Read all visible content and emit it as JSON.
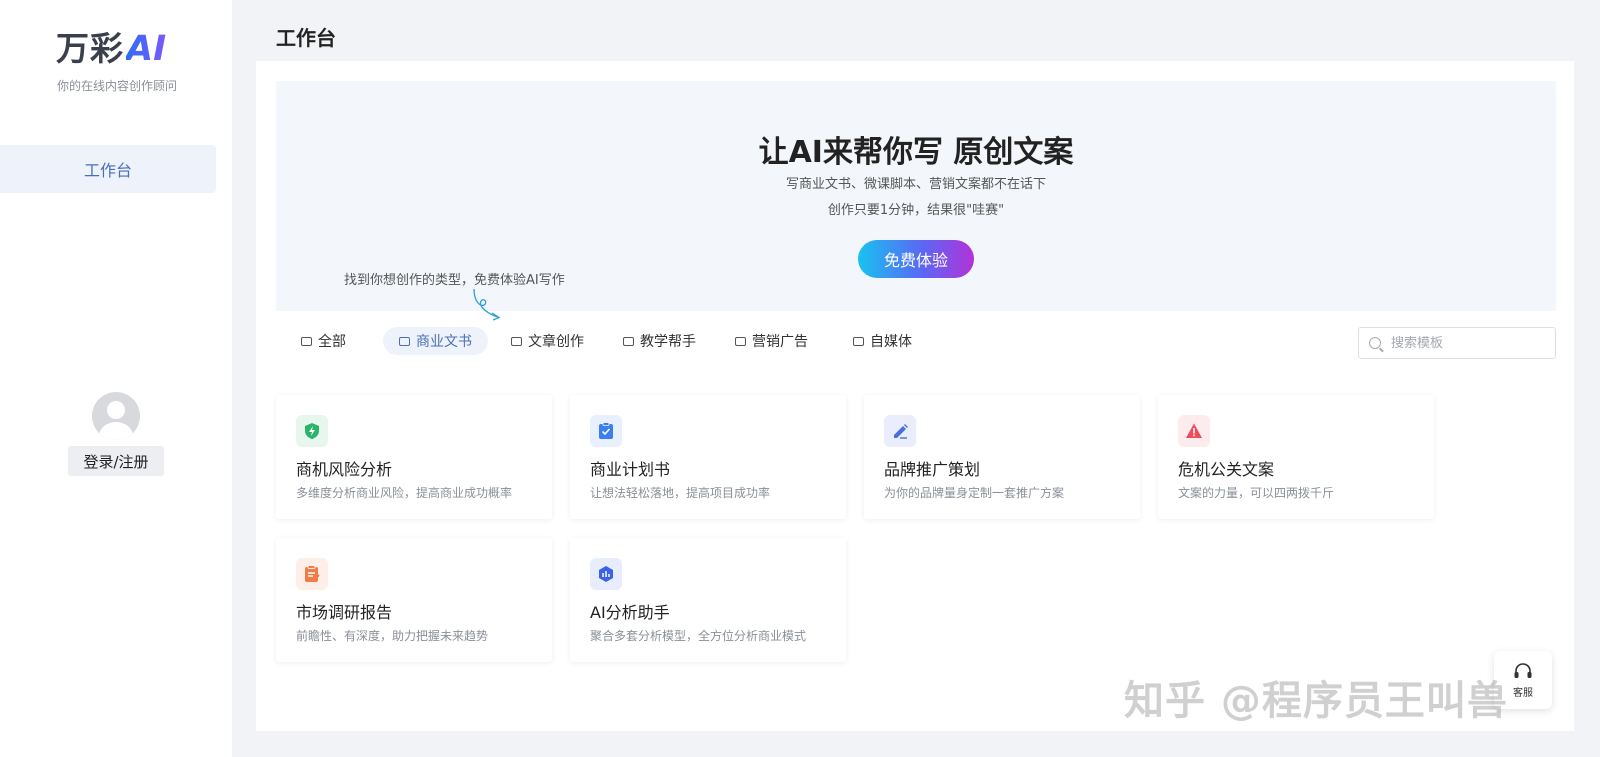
{
  "sidebar": {
    "logo_text": "万彩",
    "logo_ai": "AI",
    "slogan": "你的在线内容创作顾问",
    "nav": [
      {
        "label": "工作台"
      }
    ],
    "login_label": "登录/注册"
  },
  "page": {
    "title": "工作台"
  },
  "banner": {
    "title": "让AI来帮你写 原创文案",
    "subtitle_1": "写商业文书、微课脚本、营销文案都不在话下",
    "subtitle_2": "创作只要1分钟，结果很\"哇赛\"",
    "cta_label": "免费体验",
    "hint": "找到你想创作的类型，免费体验AI写作"
  },
  "tabs": [
    {
      "label": "全部",
      "active": false
    },
    {
      "label": "商业文书",
      "active": true
    },
    {
      "label": "文章创作",
      "active": false
    },
    {
      "label": "教学帮手",
      "active": false
    },
    {
      "label": "营销广告",
      "active": false
    },
    {
      "label": "自媒体",
      "active": false
    }
  ],
  "search": {
    "placeholder": "搜索模板"
  },
  "cards": [
    {
      "title": "商机风险分析",
      "desc": "多维度分析商业风险，提高商业成功概率",
      "icon": "shield-bolt-icon",
      "color": "#2bb36a",
      "bg": "#e8f7ee"
    },
    {
      "title": "商业计划书",
      "desc": "让想法轻松落地，提高项目成功率",
      "icon": "clipboard-check-icon",
      "color": "#3a7ef0",
      "bg": "#e8f0fd"
    },
    {
      "title": "品牌推广策划",
      "desc": "为你的品牌量身定制一套推广方案",
      "icon": "pen-edit-icon",
      "color": "#4a6fe0",
      "bg": "#e9edfc"
    },
    {
      "title": "危机公关文案",
      "desc": "文案的力量，可以四两拨千斤",
      "icon": "warning-icon",
      "color": "#ef4b5a",
      "bg": "#fdecee"
    },
    {
      "title": "市场调研报告",
      "desc": "前瞻性、有深度，助力把握未来趋势",
      "icon": "report-icon",
      "color": "#f07c4a",
      "bg": "#fdefe8"
    },
    {
      "title": "AI分析助手",
      "desc": "聚合多套分析模型，全方位分析商业模式",
      "icon": "hexagon-chart-icon",
      "color": "#3b62e8",
      "bg": "#e8edfd"
    }
  ],
  "float": {
    "label": "客服"
  },
  "watermark": "知乎 @程序员王叫兽"
}
